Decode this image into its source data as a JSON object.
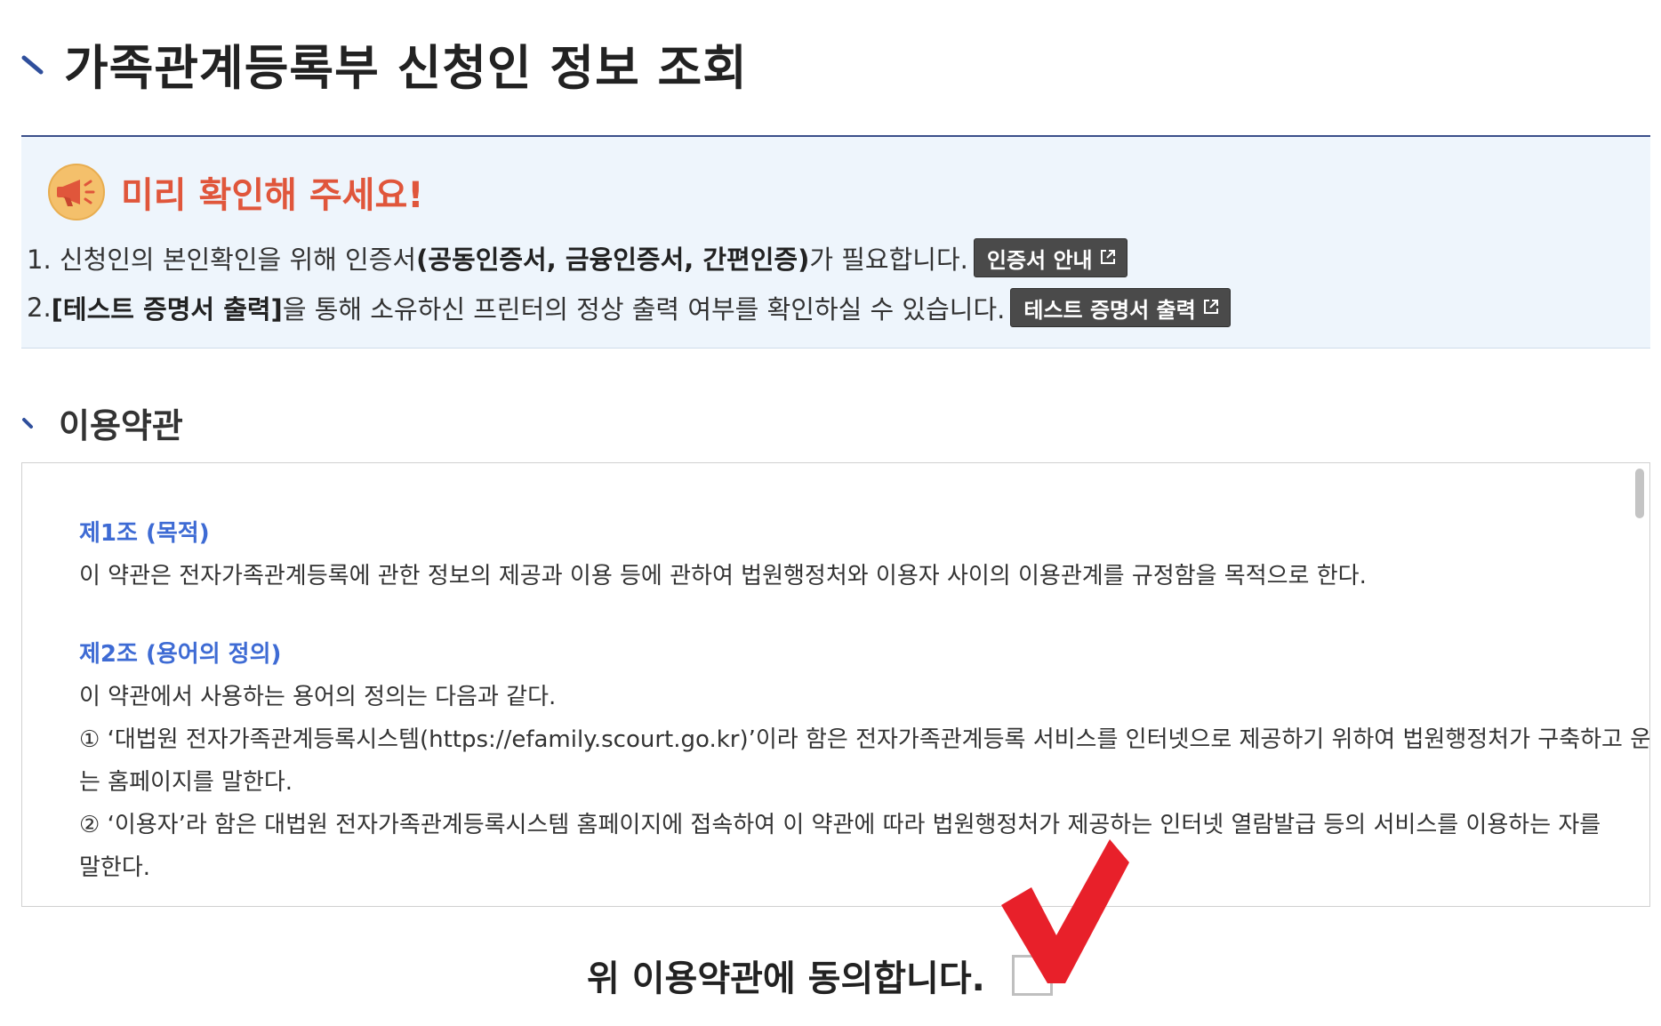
{
  "header": {
    "title": "가족관계등록부 신청인 정보 조회"
  },
  "notice": {
    "title": "미리 확인해 주세요!",
    "line1": {
      "prefix": "1. 신청인의 본인확인을 위해 인증서",
      "bold": "(공동인증서, 금융인증서, 간편인증)",
      "suffix": "가 필요합니다.",
      "button_label": "인증서 안내"
    },
    "line2": {
      "prefix": "2. ",
      "bold": "[테스트 증명서 출력]",
      "suffix": "을 통해 소유하신 프린터의 정상 출력 여부를 확인하실 수 있습니다.",
      "button_label": "테스트 증명서 출력"
    }
  },
  "terms": {
    "section_title": "이용약관",
    "articles": [
      {
        "title": "제1조 (목적)",
        "paragraphs": [
          "이 약관은 전자가족관계등록에 관한 정보의 제공과 이용 등에 관하여 법원행정처와 이용자 사이의 이용관계를 규정함을 목적으로 한다."
        ]
      },
      {
        "title": "제2조 (용어의 정의)",
        "paragraphs": [
          "이 약관에서 사용하는 용어의 정의는 다음과 같다.",
          "① ‘대법원 전자가족관계등록시스템(https://efamily.scourt.go.kr)’이라 함은 전자가족관계등록 서비스를 인터넷으로 제공하기 위하여 법원행정처가 구축하고 운영하",
          "는 홈페이지를 말한다.",
          "② ‘이용자’라 함은 대법원 전자가족관계등록시스템 홈페이지에 접속하여 이 약관에 따라 법원행정처가 제공하는 인터넷 열람발급 등의 서비스를 이용하는 자를",
          "말한다."
        ]
      }
    ]
  },
  "agree": {
    "label": "위 이용약관에 동의합니다."
  },
  "colors": {
    "accent_blue": "#3e6bd4",
    "notice_red": "#e0563b",
    "notice_bg": "#eef5fc",
    "rule": "#3a4f8a",
    "check_red": "#e8202a"
  }
}
